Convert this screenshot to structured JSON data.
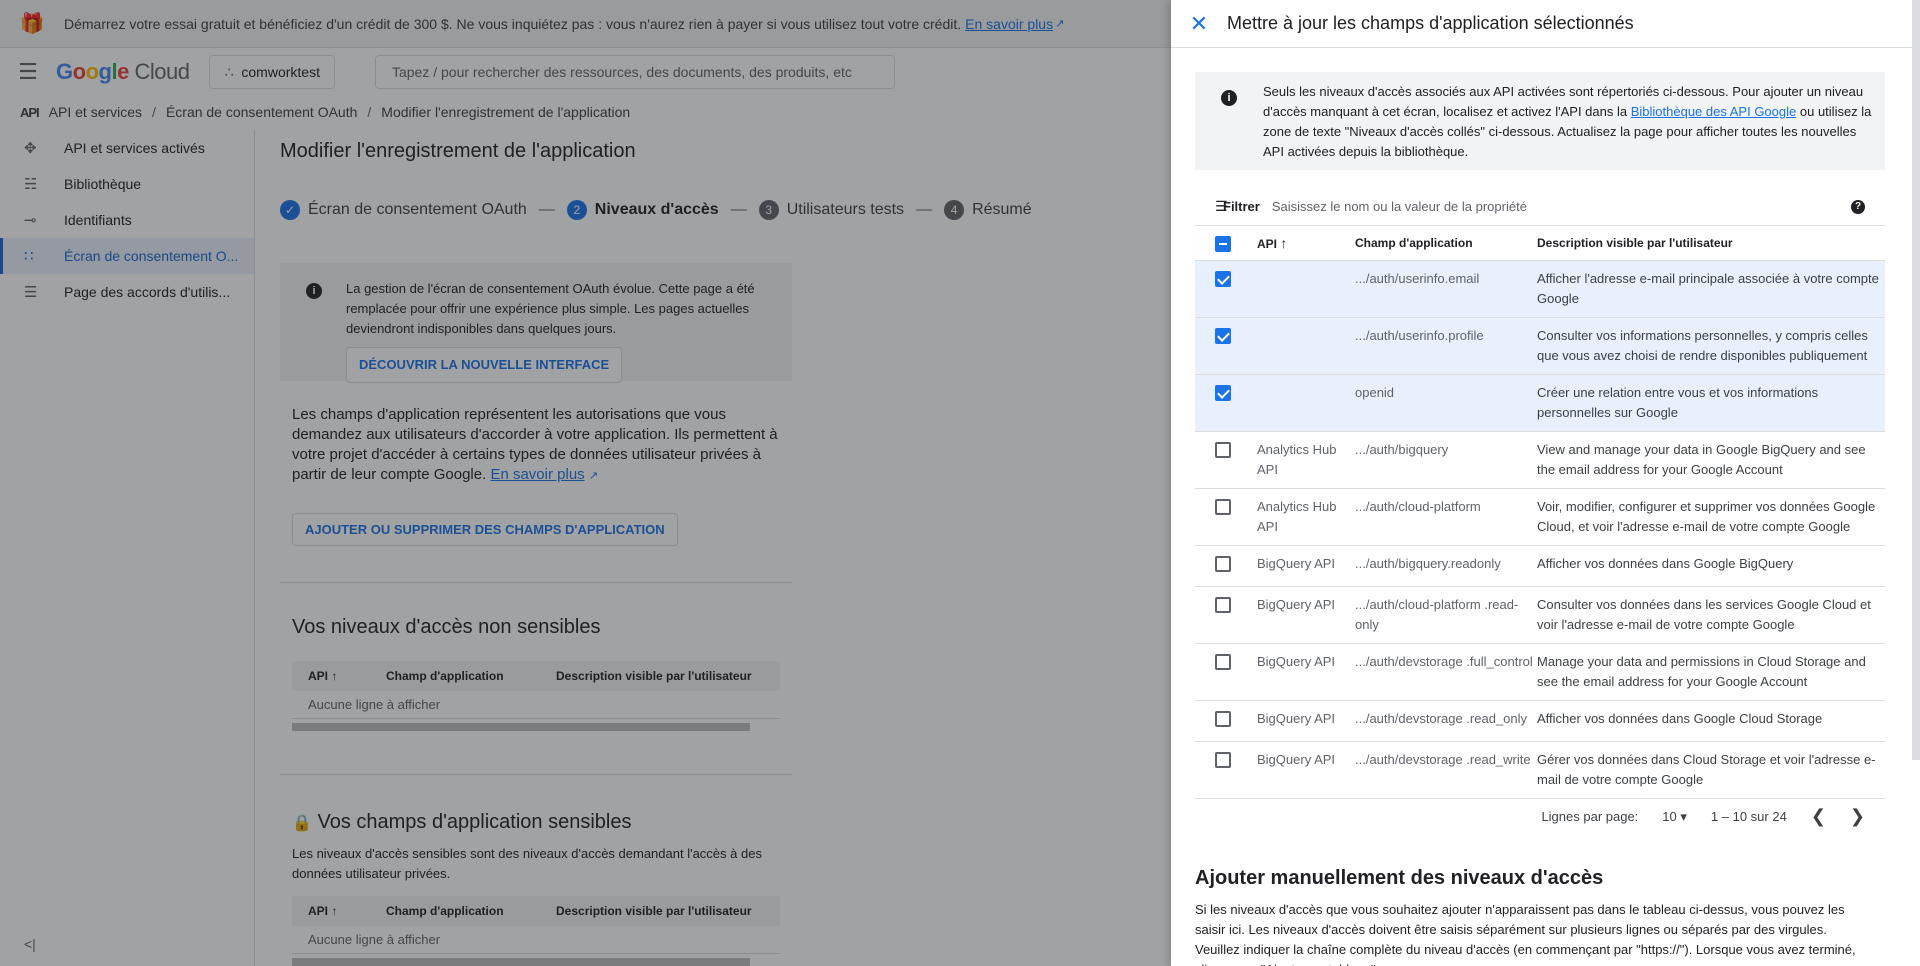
{
  "promo": {
    "text": "Démarrez votre essai gratuit et bénéficiez d'un crédit de 300 $. Ne vous inquiétez pas : vous n'aurez rien à payer si vous utilisez tout votre crédit.",
    "link": "En savoir plus"
  },
  "header": {
    "logo_google": "Google",
    "logo_cloud": "Cloud",
    "project": "comworktest",
    "search_placeholder": "Tapez / pour rechercher des ressources, des documents, des produits, etc"
  },
  "breadcrumb": {
    "glyph": "API",
    "items": [
      "API et services",
      "Écran de consentement OAuth",
      "Modifier l'enregistrement de l'application"
    ]
  },
  "sidebar": {
    "items": [
      {
        "label": "API et services activés",
        "icon": "diamond-icon"
      },
      {
        "label": "Bibliothèque",
        "icon": "library-icon"
      },
      {
        "label": "Identifiants",
        "icon": "key-icon"
      },
      {
        "label": "Écran de consentement O...",
        "icon": "consent-icon"
      },
      {
        "label": "Page des accords d'utilis...",
        "icon": "settings-list-icon"
      }
    ],
    "collapse": "<|"
  },
  "main": {
    "title": "Modifier l'enregistrement de l'application",
    "steps": [
      {
        "num": "✓",
        "label": "Écran de consentement OAuth"
      },
      {
        "num": "2",
        "label": "Niveaux d'accès"
      },
      {
        "num": "3",
        "label": "Utilisateurs tests"
      },
      {
        "num": "4",
        "label": "Résumé"
      }
    ],
    "info": "La gestion de l'écran de consentement OAuth évolue. Cette page a été remplacée pour offrir une expérience plus simple. Les pages actuelles deviendront indisponibles dans quelques jours.",
    "info_button": "DÉCOUVRIR LA NOUVELLE INTERFACE",
    "desc": "Les champs d'application représentent les autorisations que vous demandez aux utilisateurs d'accorder à votre application. Ils permettent à votre projet d'accéder à certains types de données utilisateur privées à partir de leur compte Google.",
    "desc_link": "En savoir plus",
    "add_button": "AJOUTER OU SUPPRIMER DES CHAMPS D'APPLICATION",
    "nonsensitive_title": "Vos niveaux d'accès non sensibles",
    "sensitive_title": "Vos champs d'application sensibles",
    "sensitive_sub": "Les niveaux d'accès sensibles sont des niveaux d'accès demandant l'accès à des données utilisateur privées.",
    "table_headers": [
      "API",
      "Champ d'application",
      "Description visible par l'utilisateur"
    ],
    "empty": "Aucune ligne à afficher"
  },
  "panel": {
    "title": "Mettre à jour les champs d'application sélectionnés",
    "info_before": "Seuls les niveaux d'accès associés aux API activées sont répertoriés ci-dessous. Pour ajouter un niveau d'accès manquant à cet écran, localisez et activez l'API dans la",
    "info_link": "Bibliothèque des API Google",
    "info_after": "ou utilisez la zone de texte \"Niveaux d'accès collés\" ci-dessous. Actualisez la page pour afficher toutes les nouvelles API activées depuis la bibliothèque.",
    "filter_label": "Filtrer",
    "filter_placeholder": "Saisissez le nom ou la valeur de la propriété",
    "headers": [
      "API",
      "Champ d'application",
      "Description visible par l'utilisateur"
    ],
    "rows": [
      {
        "checked": true,
        "api": "",
        "scope": ".../auth/userinfo.email",
        "desc": "Afficher l'adresse e-mail principale associée à votre compte Google"
      },
      {
        "checked": true,
        "api": "",
        "scope": ".../auth/userinfo.profile",
        "desc": "Consulter vos informations personnelles, y compris celles que vous avez choisi de rendre disponibles publiquement"
      },
      {
        "checked": true,
        "api": "",
        "scope": "openid",
        "desc": "Créer une relation entre vous et vos informations personnelles sur Google"
      },
      {
        "checked": false,
        "api": "Analytics Hub API",
        "scope": ".../auth/bigquery",
        "desc": "View and manage your data in Google BigQuery and see the email address for your Google Account"
      },
      {
        "checked": false,
        "api": "Analytics Hub API",
        "scope": ".../auth/cloud-platform",
        "desc": "Voir, modifier, configurer et supprimer vos données Google Cloud, et voir l'adresse e-mail de votre compte Google"
      },
      {
        "checked": false,
        "api": "BigQuery API",
        "scope": ".../auth/bigquery.readonly",
        "desc": "Afficher vos données dans Google BigQuery"
      },
      {
        "checked": false,
        "api": "BigQuery API",
        "scope": ".../auth/cloud-platform .read-only",
        "desc": "Consulter vos données dans les services Google Cloud et voir l'adresse e-mail de votre compte Google"
      },
      {
        "checked": false,
        "api": "BigQuery API",
        "scope": ".../auth/devstorage .full_control",
        "desc": "Manage your data and permissions in Cloud Storage and see the email address for your Google Account"
      },
      {
        "checked": false,
        "api": "BigQuery API",
        "scope": ".../auth/devstorage .read_only",
        "desc": "Afficher vos données dans Google Cloud Storage"
      },
      {
        "checked": false,
        "api": "BigQuery API",
        "scope": ".../auth/devstorage .read_write",
        "desc": "Gérer vos données dans Cloud Storage et voir l'adresse e-mail de votre compte Google"
      }
    ],
    "pager": {
      "rows_label": "Lignes par page:",
      "rows_value": "10",
      "range": "1 – 10 sur 24"
    },
    "manual_title": "Ajouter manuellement des niveaux d'accès",
    "manual_text": "Si les niveaux d'accès que vous souhaitez ajouter n'apparaissent pas dans le tableau ci-dessus, vous pouvez les saisir ici. Les niveaux d'accès doivent être saisis séparément sur plusieurs lignes ou séparés par des virgules. Veuillez indiquer la chaîne complète du niveau d'accès (en commençant par \"https://\"). Lorsque vous avez terminé, cliquez sur \"Ajouter au tableau\"."
  }
}
